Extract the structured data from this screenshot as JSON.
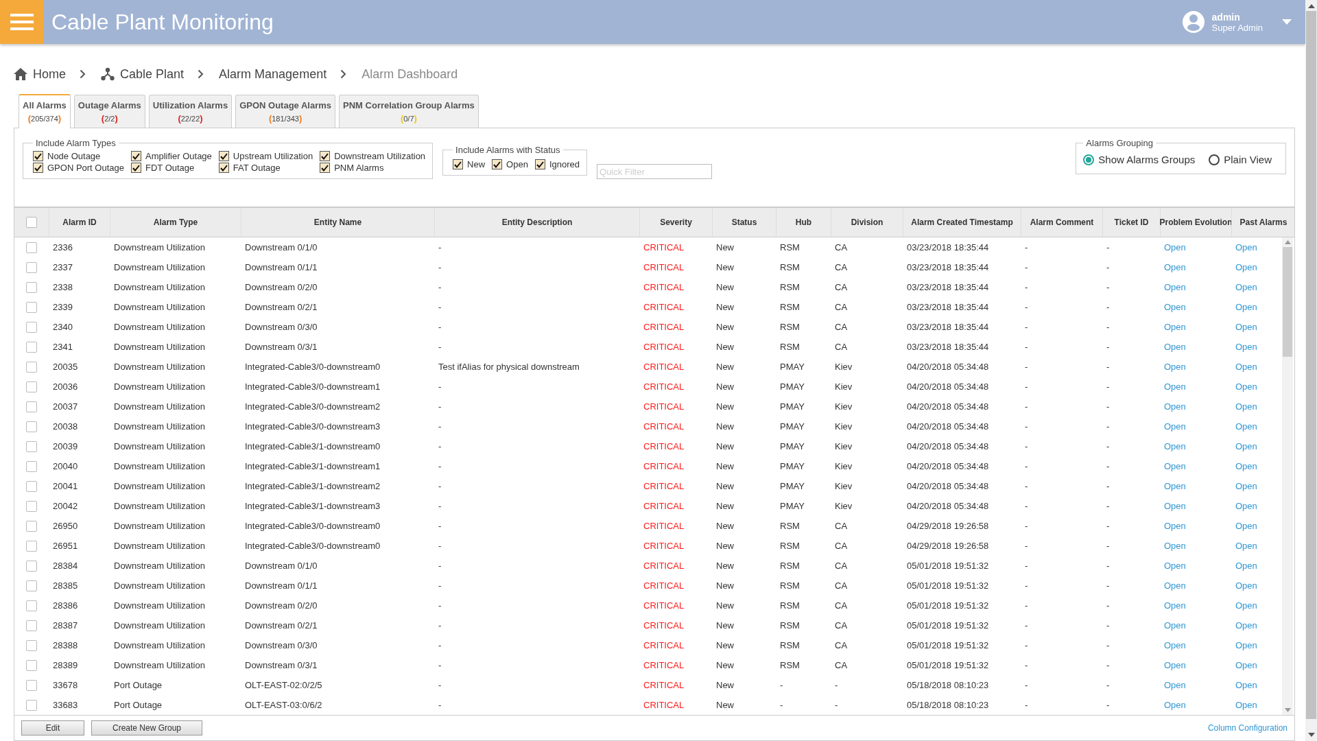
{
  "header": {
    "title": "Cable Plant Monitoring",
    "user": {
      "name": "admin",
      "role": "Super Admin"
    }
  },
  "breadcrumb": [
    {
      "label": "Home",
      "kind": "home"
    },
    {
      "label": "Cable Plant",
      "kind": "plant"
    },
    {
      "label": "Alarm Management",
      "kind": "section"
    },
    {
      "label": "Alarm Dashboard",
      "kind": "current"
    }
  ],
  "tabs": [
    {
      "label": "All Alarms",
      "count": "(205/374)",
      "color": "#f07a1a",
      "selected": true
    },
    {
      "label": "Outage Alarms",
      "count": "(2/2)",
      "color": "#e0201c",
      "selected": false
    },
    {
      "label": "Utilization Alarms",
      "count": "(22/22)",
      "color": "#e0201c",
      "selected": false
    },
    {
      "label": "GPON Outage Alarms",
      "count": "(181/343)",
      "color": "#f07a1a",
      "selected": false
    },
    {
      "label": "PNM Correlation Group Alarms",
      "count": "(0/7)",
      "color": "#f2c80f",
      "selected": false
    }
  ],
  "alarm_types": {
    "legend": "Include Alarm Types",
    "items": [
      {
        "label": "Node Outage",
        "checked": true
      },
      {
        "label": "Amplifier Outage",
        "checked": true
      },
      {
        "label": "Upstream Utilization",
        "checked": true
      },
      {
        "label": "Downstream Utilization",
        "checked": true
      },
      {
        "label": "GPON Port Outage",
        "checked": true
      },
      {
        "label": "FDT Outage",
        "checked": true
      },
      {
        "label": "FAT Outage",
        "checked": true
      },
      {
        "label": "PNM Alarms",
        "checked": true
      }
    ]
  },
  "alarm_status": {
    "legend": "Include Alarms with Status",
    "items": [
      {
        "label": "New",
        "checked": true
      },
      {
        "label": "Open",
        "checked": true
      },
      {
        "label": "Ignored",
        "checked": true
      }
    ]
  },
  "quick_filter": {
    "placeholder": "Quick Filter"
  },
  "grouping": {
    "legend": "Alarms Grouping",
    "options": [
      {
        "label": "Show Alarms Groups",
        "selected": true
      },
      {
        "label": "Plain View",
        "selected": false
      }
    ]
  },
  "table": {
    "select_all": {
      "checked": false
    },
    "columns": [
      "Alarm ID",
      "Alarm Type",
      "Entity Name",
      "Entity Description",
      "Severity",
      "Status",
      "Hub",
      "Division",
      "Alarm Created Timestamp",
      "Alarm Comment",
      "Ticket ID",
      "Problem Evolution",
      "Past Alarms"
    ],
    "rows": [
      {
        "checked": false,
        "cells": [
          "2336",
          "Downstream Utilization",
          "Downstream 0/1/0",
          "-",
          "CRITICAL",
          "New",
          "RSM",
          "CA",
          "03/23/2018 18:35:44",
          "-",
          "-",
          "Open",
          "Open"
        ]
      },
      {
        "checked": false,
        "cells": [
          "2337",
          "Downstream Utilization",
          "Downstream 0/1/1",
          "-",
          "CRITICAL",
          "New",
          "RSM",
          "CA",
          "03/23/2018 18:35:44",
          "-",
          "-",
          "Open",
          "Open"
        ]
      },
      {
        "checked": false,
        "cells": [
          "2338",
          "Downstream Utilization",
          "Downstream 0/2/0",
          "-",
          "CRITICAL",
          "New",
          "RSM",
          "CA",
          "03/23/2018 18:35:44",
          "-",
          "-",
          "Open",
          "Open"
        ]
      },
      {
        "checked": false,
        "cells": [
          "2339",
          "Downstream Utilization",
          "Downstream 0/2/1",
          "-",
          "CRITICAL",
          "New",
          "RSM",
          "CA",
          "03/23/2018 18:35:44",
          "-",
          "-",
          "Open",
          "Open"
        ]
      },
      {
        "checked": false,
        "cells": [
          "2340",
          "Downstream Utilization",
          "Downstream 0/3/0",
          "-",
          "CRITICAL",
          "New",
          "RSM",
          "CA",
          "03/23/2018 18:35:44",
          "-",
          "-",
          "Open",
          "Open"
        ]
      },
      {
        "checked": false,
        "cells": [
          "2341",
          "Downstream Utilization",
          "Downstream 0/3/1",
          "-",
          "CRITICAL",
          "New",
          "RSM",
          "CA",
          "03/23/2018 18:35:44",
          "-",
          "-",
          "Open",
          "Open"
        ]
      },
      {
        "checked": false,
        "cells": [
          "20035",
          "Downstream Utilization",
          "Integrated-Cable3/0-downstream0",
          "Test ifAlias for physical downstream",
          "CRITICAL",
          "New",
          "PMAY",
          "Kiev",
          "04/20/2018 05:34:48",
          "-",
          "-",
          "Open",
          "Open"
        ]
      },
      {
        "checked": false,
        "cells": [
          "20036",
          "Downstream Utilization",
          "Integrated-Cable3/0-downstream1",
          "-",
          "CRITICAL",
          "New",
          "PMAY",
          "Kiev",
          "04/20/2018 05:34:48",
          "-",
          "-",
          "Open",
          "Open"
        ]
      },
      {
        "checked": false,
        "cells": [
          "20037",
          "Downstream Utilization",
          "Integrated-Cable3/0-downstream2",
          "-",
          "CRITICAL",
          "New",
          "PMAY",
          "Kiev",
          "04/20/2018 05:34:48",
          "-",
          "-",
          "Open",
          "Open"
        ]
      },
      {
        "checked": false,
        "cells": [
          "20038",
          "Downstream Utilization",
          "Integrated-Cable3/0-downstream3",
          "-",
          "CRITICAL",
          "New",
          "PMAY",
          "Kiev",
          "04/20/2018 05:34:48",
          "-",
          "-",
          "Open",
          "Open"
        ]
      },
      {
        "checked": false,
        "cells": [
          "20039",
          "Downstream Utilization",
          "Integrated-Cable3/1-downstream0",
          "-",
          "CRITICAL",
          "New",
          "PMAY",
          "Kiev",
          "04/20/2018 05:34:48",
          "-",
          "-",
          "Open",
          "Open"
        ]
      },
      {
        "checked": false,
        "cells": [
          "20040",
          "Downstream Utilization",
          "Integrated-Cable3/1-downstream1",
          "-",
          "CRITICAL",
          "New",
          "PMAY",
          "Kiev",
          "04/20/2018 05:34:48",
          "-",
          "-",
          "Open",
          "Open"
        ]
      },
      {
        "checked": false,
        "cells": [
          "20041",
          "Downstream Utilization",
          "Integrated-Cable3/1-downstream2",
          "-",
          "CRITICAL",
          "New",
          "PMAY",
          "Kiev",
          "04/20/2018 05:34:48",
          "-",
          "-",
          "Open",
          "Open"
        ]
      },
      {
        "checked": false,
        "cells": [
          "20042",
          "Downstream Utilization",
          "Integrated-Cable3/1-downstream3",
          "-",
          "CRITICAL",
          "New",
          "PMAY",
          "Kiev",
          "04/20/2018 05:34:48",
          "-",
          "-",
          "Open",
          "Open"
        ]
      },
      {
        "checked": false,
        "cells": [
          "26950",
          "Downstream Utilization",
          "Integrated-Cable3/0-downstream0",
          "-",
          "CRITICAL",
          "New",
          "RSM",
          "CA",
          "04/29/2018 19:26:58",
          "-",
          "-",
          "Open",
          "Open"
        ]
      },
      {
        "checked": false,
        "cells": [
          "26951",
          "Downstream Utilization",
          "Integrated-Cable3/0-downstream0",
          "-",
          "CRITICAL",
          "New",
          "RSM",
          "CA",
          "04/29/2018 19:26:58",
          "-",
          "-",
          "Open",
          "Open"
        ]
      },
      {
        "checked": false,
        "cells": [
          "28384",
          "Downstream Utilization",
          "Downstream 0/1/0",
          "-",
          "CRITICAL",
          "New",
          "RSM",
          "CA",
          "05/01/2018 19:51:32",
          "-",
          "-",
          "Open",
          "Open"
        ]
      },
      {
        "checked": false,
        "cells": [
          "28385",
          "Downstream Utilization",
          "Downstream 0/1/1",
          "-",
          "CRITICAL",
          "New",
          "RSM",
          "CA",
          "05/01/2018 19:51:32",
          "-",
          "-",
          "Open",
          "Open"
        ]
      },
      {
        "checked": false,
        "cells": [
          "28386",
          "Downstream Utilization",
          "Downstream 0/2/0",
          "-",
          "CRITICAL",
          "New",
          "RSM",
          "CA",
          "05/01/2018 19:51:32",
          "-",
          "-",
          "Open",
          "Open"
        ]
      },
      {
        "checked": false,
        "cells": [
          "28387",
          "Downstream Utilization",
          "Downstream 0/2/1",
          "-",
          "CRITICAL",
          "New",
          "RSM",
          "CA",
          "05/01/2018 19:51:32",
          "-",
          "-",
          "Open",
          "Open"
        ]
      },
      {
        "checked": false,
        "cells": [
          "28388",
          "Downstream Utilization",
          "Downstream 0/3/0",
          "-",
          "CRITICAL",
          "New",
          "RSM",
          "CA",
          "05/01/2018 19:51:32",
          "-",
          "-",
          "Open",
          "Open"
        ]
      },
      {
        "checked": false,
        "cells": [
          "28389",
          "Downstream Utilization",
          "Downstream 0/3/1",
          "-",
          "CRITICAL",
          "New",
          "RSM",
          "CA",
          "05/01/2018 19:51:32",
          "-",
          "-",
          "Open",
          "Open"
        ]
      },
      {
        "checked": false,
        "cells": [
          "33678",
          "Port Outage",
          "OLT-EAST-02:0/2/5",
          "-",
          "CRITICAL",
          "New",
          "-",
          "-",
          "05/18/2018 08:10:23",
          "-",
          "-",
          "Open",
          "Open"
        ]
      },
      {
        "checked": false,
        "cells": [
          "33683",
          "Port Outage",
          "OLT-EAST-03:0/6/2",
          "-",
          "CRITICAL",
          "New",
          "-",
          "-",
          "05/18/2018 08:10:23",
          "-",
          "-",
          "Open",
          "Open"
        ]
      }
    ]
  },
  "footer": {
    "buttons": [
      "Edit",
      "Create New Group"
    ],
    "link": "Column Configuration"
  }
}
